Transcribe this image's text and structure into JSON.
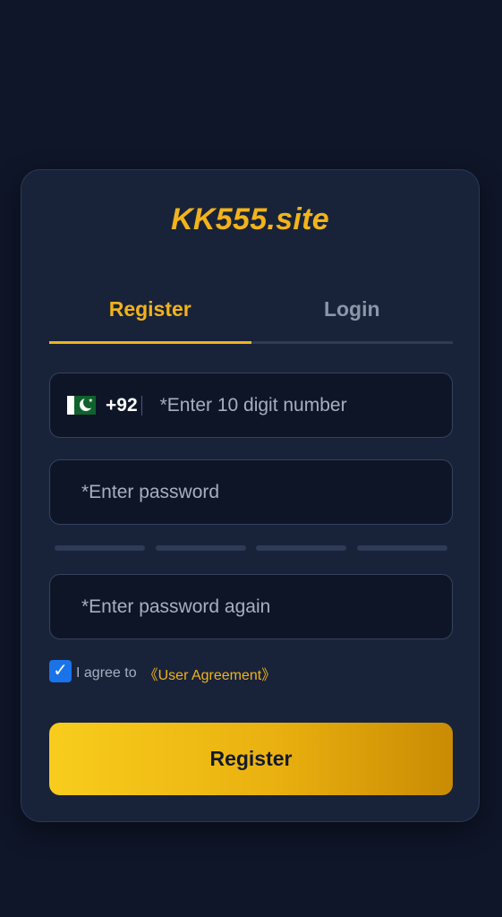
{
  "brand": {
    "title": "KK555.site"
  },
  "tabs": [
    {
      "label": "Register",
      "active": true
    },
    {
      "label": "Login",
      "active": false
    }
  ],
  "phone": {
    "flag_icon": "pakistan-flag-icon",
    "dial_code": "+92",
    "placeholder": "*Enter 10 digit number",
    "value": ""
  },
  "password": {
    "placeholder": "*Enter password",
    "value": ""
  },
  "password_strength": {
    "segments": 4,
    "filled": 0
  },
  "password_confirm": {
    "placeholder": "*Enter password again",
    "value": ""
  },
  "agreement": {
    "checked": true,
    "text": "I agree to",
    "link": "《User Agreement》"
  },
  "submit": {
    "label": "Register"
  },
  "colors": {
    "background": "#0f1629",
    "card": "#18233a",
    "accent": "#f2b31a",
    "checkbox": "#1a73e8"
  }
}
